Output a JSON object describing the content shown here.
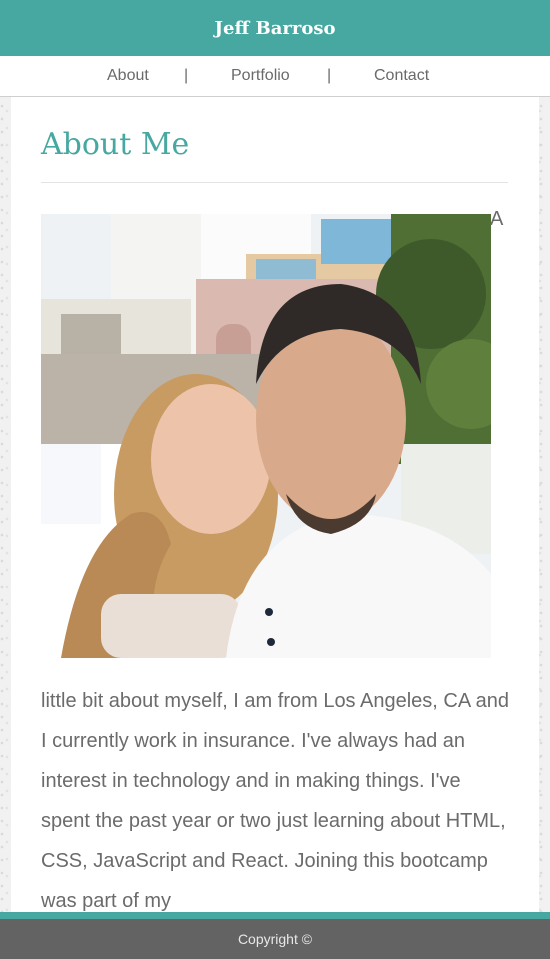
{
  "header": {
    "title": "Jeff Barroso"
  },
  "nav": {
    "items": [
      {
        "label": "About"
      },
      {
        "label": "Portfolio"
      },
      {
        "label": "Contact"
      }
    ],
    "separator": "|"
  },
  "main": {
    "heading": "About Me",
    "photo_icon": "couple-photo",
    "bio_first_word": "A",
    "bio_text": "little bit about myself, I am from Los Angeles, CA and I currently work in insurance. I've always had an interest in technology and in making things. I've spent the past year or two just learning about HTML, CSS, JavaScript and React. Joining this bootcamp was part of my"
  },
  "footer": {
    "copyright": "Copyright ©"
  },
  "colors": {
    "accent": "#47a8a1",
    "footer": "#636363",
    "text": "#6b6b6b"
  }
}
